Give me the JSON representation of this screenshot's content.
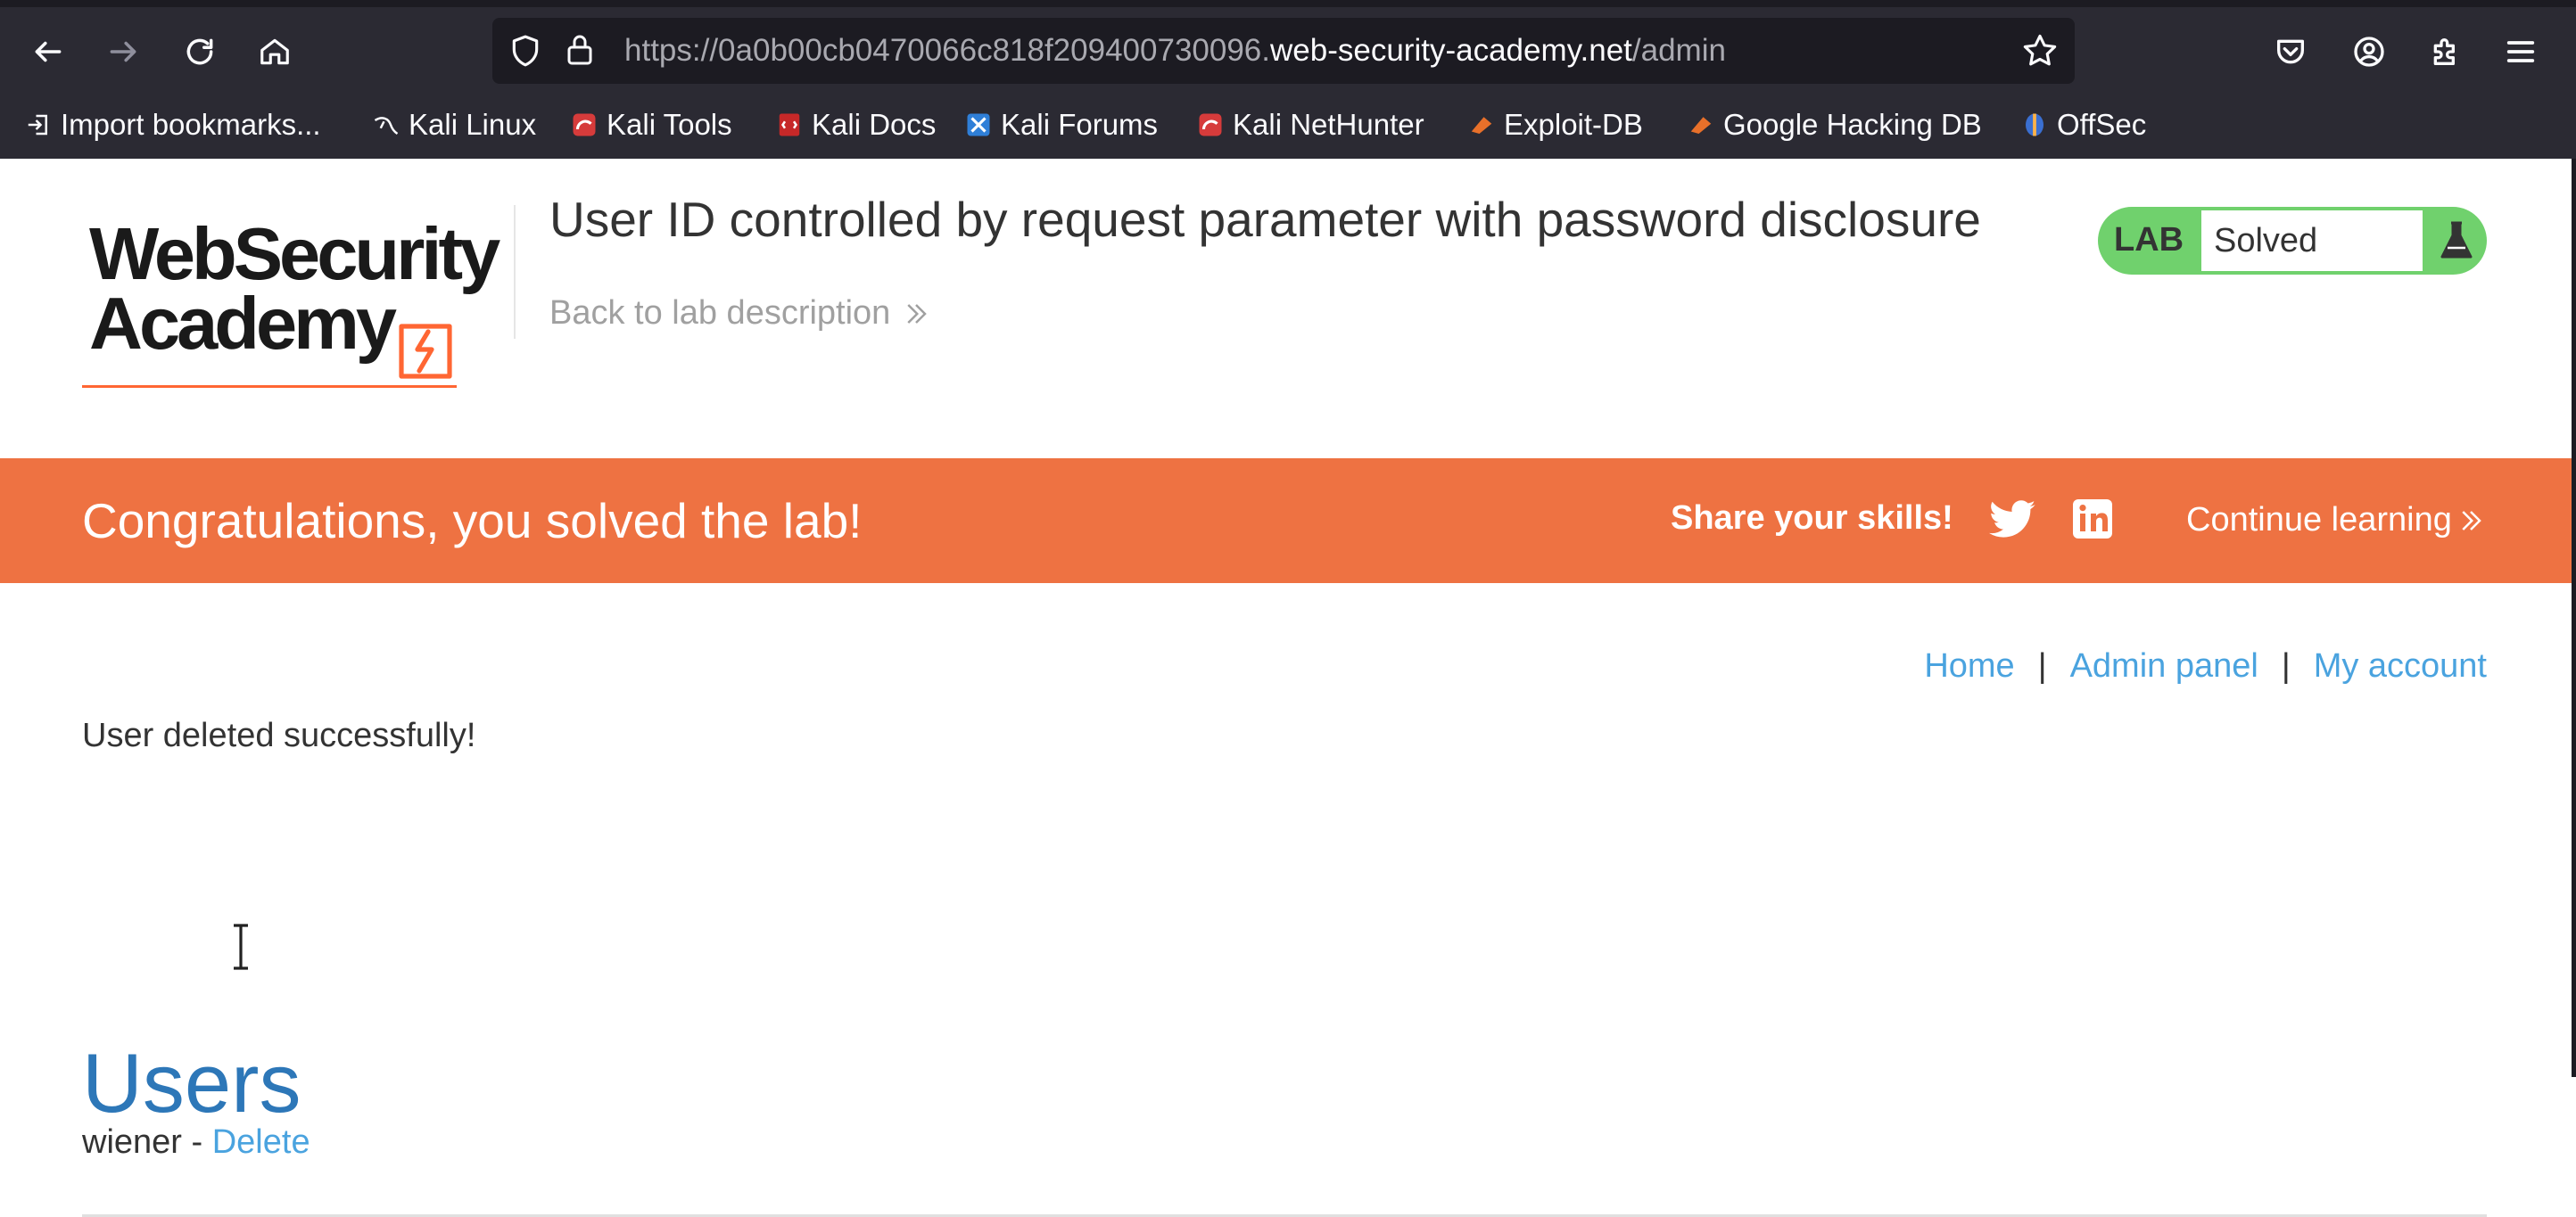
{
  "browser": {
    "url_prefix": "https://0a0b00cb0470066c818f209400730096.",
    "url_domain": "web-security-academy.net",
    "url_path": "/admin",
    "bookmarks": [
      {
        "label": "Import bookmarks...",
        "icon": "import-icon"
      },
      {
        "label": "Kali Linux",
        "icon": "kali-dragon-icon"
      },
      {
        "label": "Kali Tools",
        "icon": "kali-tools-icon"
      },
      {
        "label": "Kali Docs",
        "icon": "kali-docs-icon"
      },
      {
        "label": "Kali Forums",
        "icon": "kali-forums-icon"
      },
      {
        "label": "Kali NetHunter",
        "icon": "kali-nethunter-icon"
      },
      {
        "label": "Exploit-DB",
        "icon": "exploit-db-icon"
      },
      {
        "label": "Google Hacking DB",
        "icon": "ghdb-icon"
      },
      {
        "label": "OffSec",
        "icon": "offsec-icon"
      }
    ]
  },
  "header": {
    "logo_line1": "WebSecurity",
    "logo_line2": "Academy",
    "lab_title": "User ID controlled by request parameter with password disclosure",
    "back_link": "Back to lab description",
    "lab_badge_label": "LAB",
    "lab_status": "Solved"
  },
  "banner": {
    "congrats": "Congratulations, you solved the lab!",
    "share": "Share your skills!",
    "continue": "Continue learning"
  },
  "nav": {
    "home": "Home",
    "sep": "|",
    "admin_panel": "Admin panel",
    "my_account": "My account"
  },
  "main": {
    "message": "User deleted successfully!",
    "heading": "Users",
    "users": [
      {
        "name": "wiener",
        "separator": " - ",
        "action": "Delete"
      }
    ]
  },
  "colors": {
    "banner": "#ee7242",
    "link": "#4aa3df",
    "heading": "#2d77b8",
    "lab_badge": "#70d16d"
  }
}
